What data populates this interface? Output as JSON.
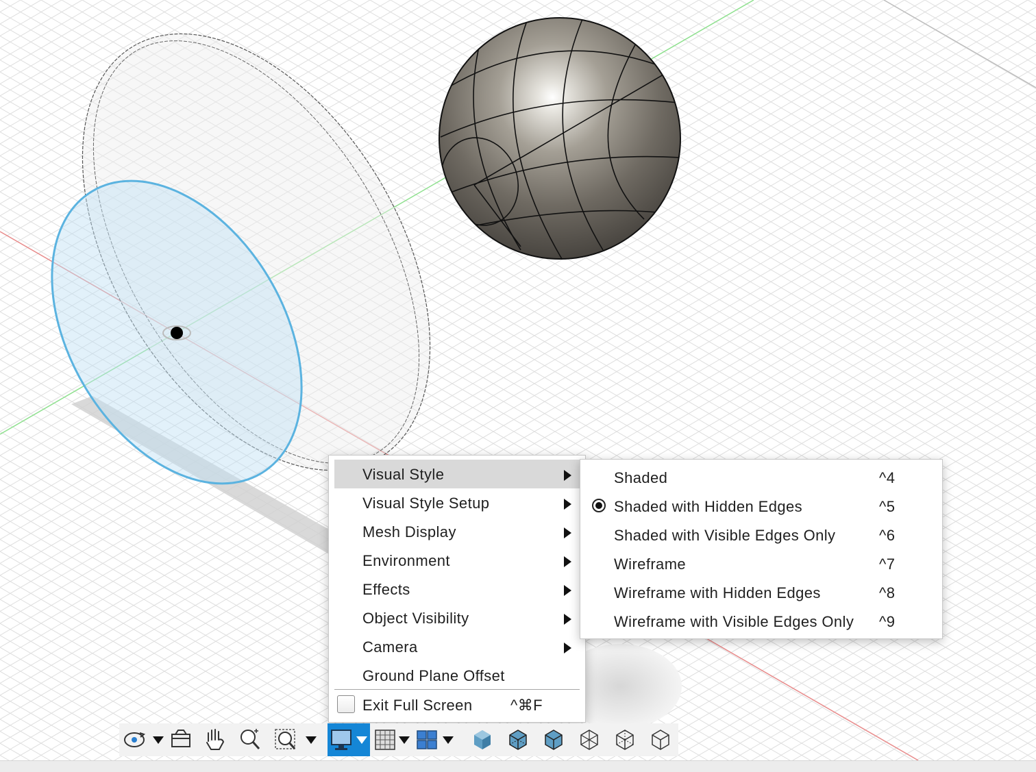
{
  "colors": {
    "accent": "#1586d6",
    "highlight": "#d9d9d9",
    "axis_x": "#e88b8b",
    "axis_y": "#8ee08e",
    "sketch": "#5bb3e0"
  },
  "main_menu": {
    "items": [
      {
        "label": "Visual Style",
        "submenu": true,
        "highlighted": true
      },
      {
        "label": "Visual Style Setup",
        "submenu": true
      },
      {
        "label": "Mesh Display",
        "submenu": true
      },
      {
        "label": "Environment",
        "submenu": true
      },
      {
        "label": "Effects",
        "submenu": true
      },
      {
        "label": "Object Visibility",
        "submenu": true
      },
      {
        "label": "Camera",
        "submenu": true
      },
      {
        "label": "Ground Plane Offset",
        "submenu": false
      }
    ],
    "exit": {
      "label": "Exit Full Screen",
      "shortcut": "^⌘F",
      "checked": false
    }
  },
  "submenu": {
    "items": [
      {
        "label": "Shaded",
        "shortcut": "^4",
        "selected": false
      },
      {
        "label": "Shaded with Hidden Edges",
        "shortcut": "^5",
        "selected": true
      },
      {
        "label": "Shaded with Visible Edges Only",
        "shortcut": "^6",
        "selected": false
      },
      {
        "label": "Wireframe",
        "shortcut": "^7",
        "selected": false
      },
      {
        "label": "Wireframe with Hidden Edges",
        "shortcut": "^8",
        "selected": false
      },
      {
        "label": "Wireframe with Visible Edges Only",
        "shortcut": "^9",
        "selected": false
      }
    ]
  },
  "toolbar": {
    "buttons": [
      {
        "icon": "orbit-icon",
        "dropdown": true
      },
      {
        "icon": "look-at-icon",
        "dropdown": false
      },
      {
        "icon": "pan-hand-icon",
        "dropdown": false
      },
      {
        "icon": "zoom-icon",
        "dropdown": false
      },
      {
        "icon": "fit-window-icon",
        "dropdown": true
      },
      {
        "icon": "display-settings-icon",
        "dropdown": true,
        "active": true
      },
      {
        "icon": "grid-snaps-icon",
        "dropdown": true
      },
      {
        "icon": "viewports-icon",
        "dropdown": true
      },
      {
        "icon": "shaded-cube-icon",
        "dropdown": false
      },
      {
        "icon": "shaded-hidden-edges-cube-icon",
        "dropdown": false
      },
      {
        "icon": "shaded-visible-edges-cube-icon",
        "dropdown": false
      },
      {
        "icon": "wireframe-cube-icon",
        "dropdown": false
      },
      {
        "icon": "wireframe-hidden-edges-cube-icon",
        "dropdown": false
      },
      {
        "icon": "wireframe-visible-edges-cube-icon",
        "dropdown": false
      }
    ]
  }
}
